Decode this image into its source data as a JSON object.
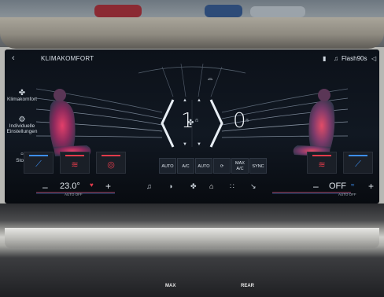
{
  "header": {
    "title": "KLIMAKOMFORT",
    "status_text": "Flash90s",
    "icons": [
      "back-arrow",
      "phone-icon",
      "music-note-icon",
      "speaker-icon"
    ]
  },
  "sidebar": {
    "items": [
      {
        "label": "Klimakomfort",
        "icon": "fan-icon"
      },
      {
        "label": "Individuelle Einstellungen",
        "icon": "gear-icon"
      },
      {
        "label": "Storn",
        "icon": "window-icon"
      }
    ]
  },
  "fan": {
    "left_level": "1",
    "right_level": "0",
    "unit": "/5"
  },
  "mode_buttons": [
    {
      "label": "AUTO",
      "sub": ""
    },
    {
      "label": "A/C",
      "sub": ""
    },
    {
      "label": "AUTO",
      "sub": ""
    },
    {
      "label": "",
      "sub": ""
    },
    {
      "label": "MAX",
      "sub": "A/C"
    },
    {
      "label": "SYNC",
      "sub": ""
    }
  ],
  "climate": {
    "left_temp": "23.0°",
    "left_sub": "AUTO OFF",
    "right_temp": "OFF",
    "right_sub": "AUTO OFF",
    "minus": "–",
    "plus": "+"
  },
  "lower_labels": {
    "left": "MAX",
    "right": "REAR"
  },
  "colors": {
    "accent_red": "#e23b4b",
    "accent_blue": "#3d8ef0",
    "screen_bg": "#0c1119"
  }
}
